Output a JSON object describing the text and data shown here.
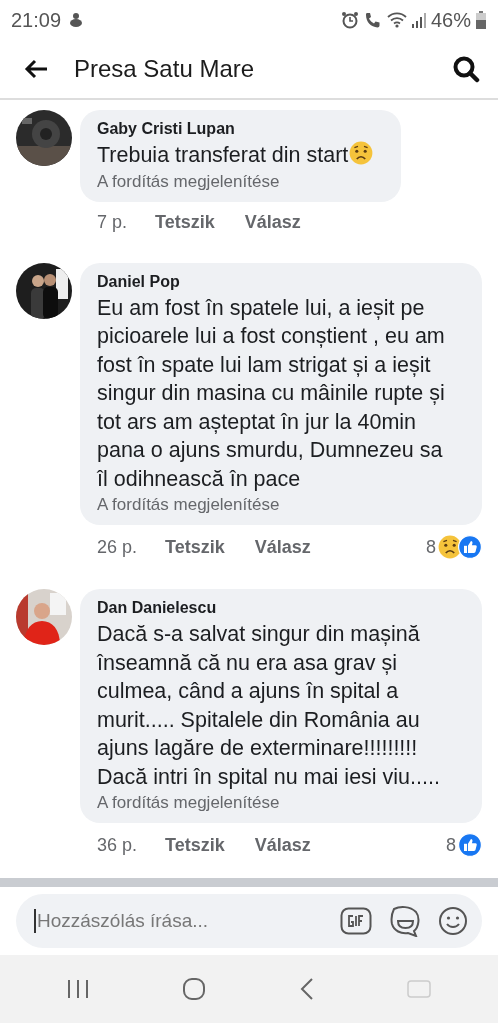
{
  "status_bar": {
    "time": "21:09",
    "battery": "46%"
  },
  "header": {
    "title": "Presa Satu Mare"
  },
  "comments": [
    {
      "author": "Gaby Cristi Lupan",
      "text": "Trebuia transferat din start",
      "emoji": [
        {
          "kind": "sad"
        }
      ],
      "translate": "A fordítás megjelenítése",
      "time": "7 p.",
      "like": "Tetszik",
      "reply": "Válasz"
    },
    {
      "author": "Daniel Pop",
      "text": "Eu am fost în spatele lui, a ieșit pe picioarele lui a fost conștient , eu am fost în spate lui lam strigat și a ieșit singur din masina cu mâinile rupte și tot ars am așteptat în jur la 40min pana o ajuns smurdu,  Dumnezeu sa îl odihnească în pace",
      "translate": "A fordítás megjelenítése",
      "time": "26 p.",
      "like": "Tetszik",
      "reply": "Válasz",
      "reaction_count": "8",
      "reactions": [
        {
          "kind": "sad"
        },
        {
          "kind": "like"
        }
      ]
    },
    {
      "author": "Dan Danielescu",
      "text": "Dacă s-a salvat singur din mașină înseamnă că nu era asa grav și culmea, când a ajuns în spital a murit..... Spitalele din România au ajuns lagăre de exterminare!!!!!!!!! Dacă intri în spital nu mai iesi viu.....",
      "translate": "A fordítás megjelenítése",
      "time": "36 p.",
      "like": "Tetszik",
      "reply": "Válasz",
      "reaction_count": "8",
      "reactions": [
        {
          "kind": "like"
        }
      ]
    }
  ],
  "composer": {
    "placeholder": "Hozzászólás írása..."
  }
}
